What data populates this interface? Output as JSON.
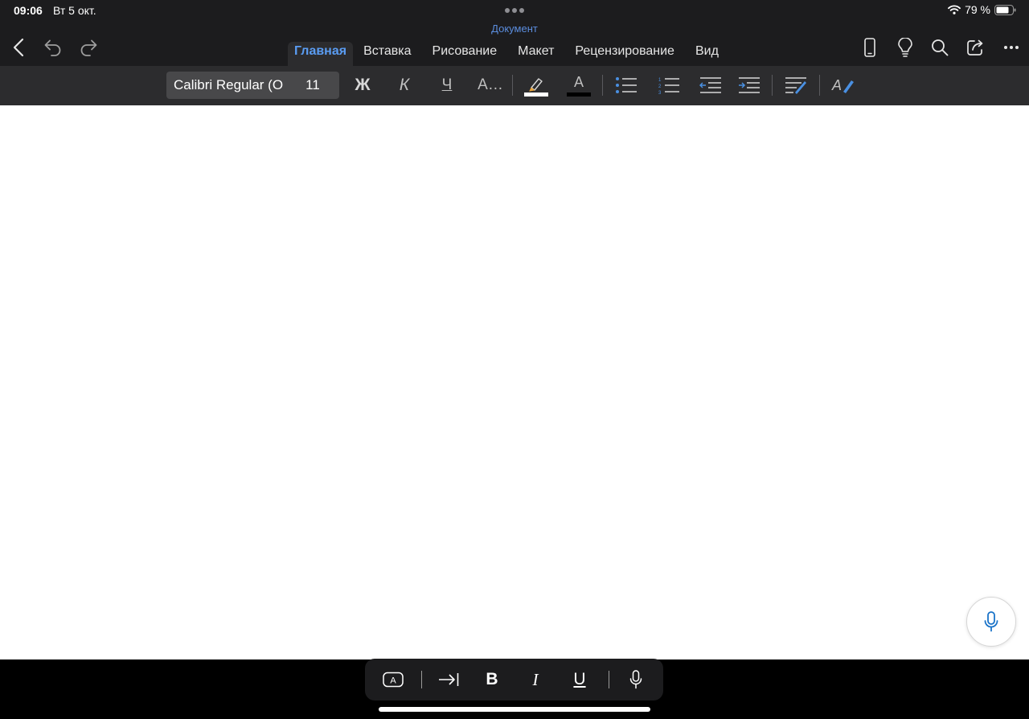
{
  "status": {
    "time": "09:06",
    "date": "Вт 5 окт.",
    "battery": "79 %"
  },
  "document": {
    "title": "Документ"
  },
  "tabs": [
    {
      "label": "Главная",
      "active": true
    },
    {
      "label": "Вставка"
    },
    {
      "label": "Рисование"
    },
    {
      "label": "Макет"
    },
    {
      "label": "Рецензирование"
    },
    {
      "label": "Вид"
    }
  ],
  "ribbon": {
    "font_name": "Calibri Regular (O",
    "font_size": "11",
    "bold": "Ж",
    "italic": "К",
    "underline": "Ч",
    "more_formatting": "A…",
    "font_color_glyph": "A",
    "styles_glyph": "A"
  },
  "keyboard_bar": {
    "bold": "B",
    "italic": "I",
    "underline": "U"
  },
  "colors": {
    "accent": "#5a9cf2",
    "highlight_swatch": "#ffffff",
    "font_color_swatch": "#000000",
    "mic": "#1a73c8"
  },
  "icons": [
    "back-icon",
    "undo-icon",
    "redo-icon",
    "phone-icon",
    "lightbulb-icon",
    "search-icon",
    "share-icon",
    "more-icon",
    "highlighter-icon",
    "bullet-list-icon",
    "numbered-list-icon",
    "decrease-indent-icon",
    "increase-indent-icon",
    "paragraph-format-icon",
    "styles-icon",
    "mic-icon",
    "text-box-icon",
    "tab-icon"
  ]
}
